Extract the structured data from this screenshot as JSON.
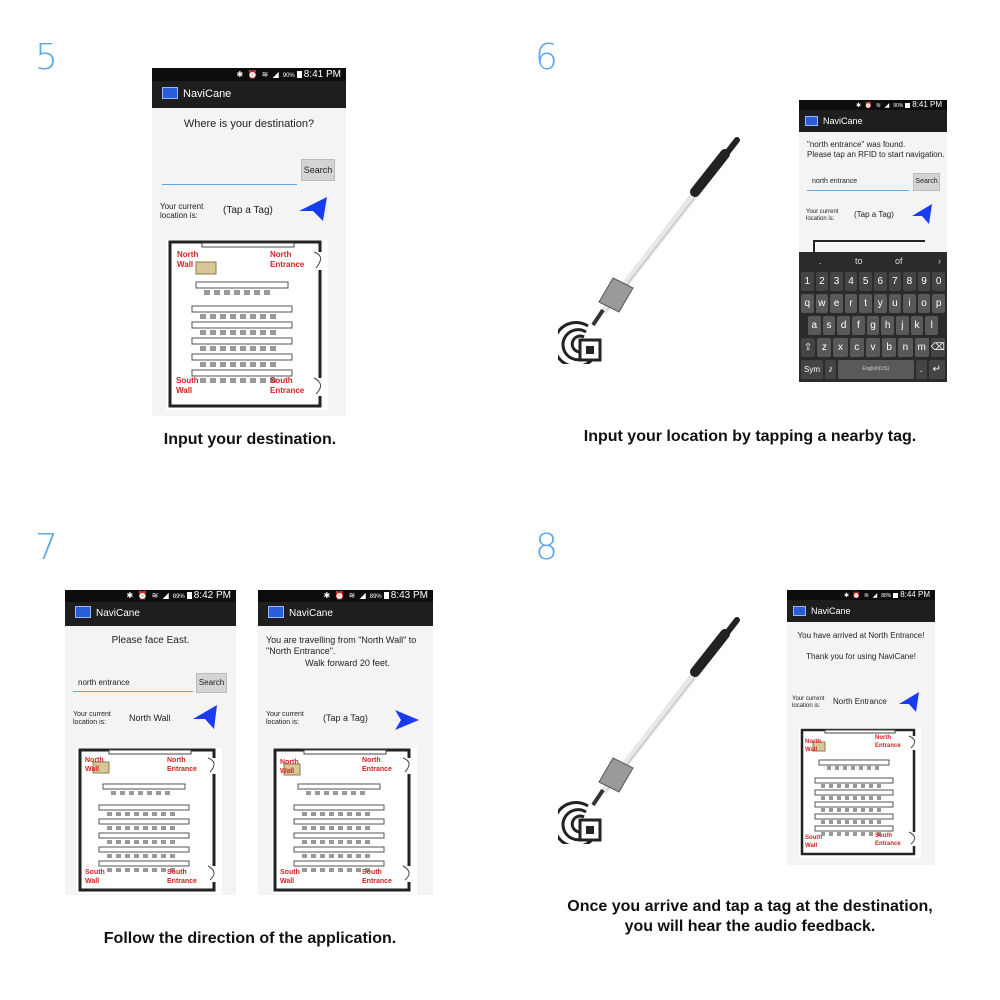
{
  "steps": [
    {
      "number": "5",
      "caption": "Input your destination."
    },
    {
      "number": "6",
      "caption": "Input your location by tapping a nearby tag."
    },
    {
      "number": "7",
      "caption": "Follow the direction of the application."
    },
    {
      "number": "8",
      "caption_line1": "Once you arrive and tap a tag at the destination,",
      "caption_line2": "you will hear the audio feedback."
    }
  ],
  "app": {
    "title": "NaviCane"
  },
  "map_labels": {
    "north_wall": "North Wall",
    "north_entrance": "North Entrance",
    "south_wall": "South Wall",
    "south_entrance": "South Entrance"
  },
  "phones": {
    "p5": {
      "time": "8:41 PM",
      "battery": "90%",
      "prompt": "Where is your destination?",
      "search_label": "Search",
      "input_value": "",
      "loc_label_1": "Your current",
      "loc_label_2": "location is:",
      "loc_value": "(Tap a Tag)"
    },
    "p6": {
      "time": "8:41 PM",
      "battery": "90%",
      "msg_line1": "\"north entrance\" was found.",
      "msg_line2": "Please tap an RFID to start navigation.",
      "input_value": "north entrance",
      "search_label": "Search",
      "loc_label_1": "Your current",
      "loc_label_2": "location is:",
      "loc_value": "(Tap a Tag)",
      "suggestions": [
        ".",
        "to",
        "of"
      ],
      "key_rows": [
        [
          "1",
          "2",
          "3",
          "4",
          "5",
          "6",
          "7",
          "8",
          "9",
          "0"
        ],
        [
          "q",
          "w",
          "e",
          "r",
          "t",
          "y",
          "u",
          "i",
          "o",
          "p"
        ],
        [
          "a",
          "s",
          "d",
          "f",
          "g",
          "h",
          "j",
          "k",
          "l"
        ],
        [
          "⇧",
          "z",
          "x",
          "c",
          "v",
          "b",
          "n",
          "m",
          "⌫"
        ]
      ],
      "sym_label": "Sym",
      "space_label": "English(US)"
    },
    "p7a": {
      "time": "8:42 PM",
      "battery": "89%",
      "prompt": "Please face East.",
      "input_value": "north entrance",
      "search_label": "Search",
      "loc_label_1": "Your current",
      "loc_label_2": "location is:",
      "loc_value": "North Wall"
    },
    "p7b": {
      "time": "8:43 PM",
      "battery": "89%",
      "msg_line1": "You are travelling from \"North Wall\" to",
      "msg_line2": "\"North Entrance\".",
      "msg_line3": "Walk forward 20 feet.",
      "loc_label_1": "Your current",
      "loc_label_2": "location is:",
      "loc_value": "(Tap a Tag)"
    },
    "p8": {
      "time": "8:44 PM",
      "battery": "88%",
      "msg_line1": "You have arrived at North Entrance!",
      "msg_line2": "Thank you for using NaviCane!",
      "loc_label_1": "Your current",
      "loc_label_2": "location is:",
      "loc_value": "North Entrance"
    }
  },
  "colors": {
    "accent": "#5aa7e6",
    "arrow": "#1a3cf0",
    "map_label": "#d22222",
    "tag": "#d8c898"
  }
}
